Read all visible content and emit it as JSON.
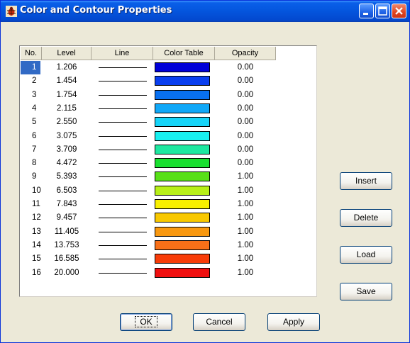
{
  "window": {
    "title": "Color and Contour Properties",
    "title_icon": "bug-app-icon",
    "controls": [
      "minimize-icon",
      "maximize-icon",
      "close-icon"
    ]
  },
  "table": {
    "headers": {
      "no": "No.",
      "level": "Level",
      "line": "Line",
      "color_table": "Color Table",
      "opacity": "Opacity"
    },
    "selected_row": 1,
    "rows": [
      {
        "no": "1",
        "level": "1.206",
        "color": "#0000d8",
        "opacity": "0.00"
      },
      {
        "no": "2",
        "level": "1.454",
        "color": "#0a3ff0",
        "opacity": "0.00"
      },
      {
        "no": "3",
        "level": "1.754",
        "color": "#0870f0",
        "opacity": "0.00"
      },
      {
        "no": "4",
        "level": "2.115",
        "color": "#10a8f8",
        "opacity": "0.00"
      },
      {
        "no": "5",
        "level": "2.550",
        "color": "#16d4f8",
        "opacity": "0.00"
      },
      {
        "no": "6",
        "level": "3.075",
        "color": "#18f0f0",
        "opacity": "0.00"
      },
      {
        "no": "7",
        "level": "3.709",
        "color": "#1ee8a0",
        "opacity": "0.00"
      },
      {
        "no": "8",
        "level": "4.472",
        "color": "#18e030",
        "opacity": "0.00"
      },
      {
        "no": "9",
        "level": "5.393",
        "color": "#58e018",
        "opacity": "1.00"
      },
      {
        "no": "10",
        "level": "6.503",
        "color": "#b8f018",
        "opacity": "1.00"
      },
      {
        "no": "11",
        "level": "7.843",
        "color": "#f8f000",
        "opacity": "1.00"
      },
      {
        "no": "12",
        "level": "9.457",
        "color": "#f8c800",
        "opacity": "1.00"
      },
      {
        "no": "13",
        "level": "11.405",
        "color": "#f89810",
        "opacity": "1.00"
      },
      {
        "no": "14",
        "level": "13.753",
        "color": "#f87018",
        "opacity": "1.00"
      },
      {
        "no": "15",
        "level": "16.585",
        "color": "#f83c08",
        "opacity": "1.00"
      },
      {
        "no": "16",
        "level": "20.000",
        "color": "#f01010",
        "opacity": "1.00"
      }
    ]
  },
  "side_buttons": {
    "insert": "Insert",
    "delete": "Delete",
    "load": "Load",
    "save": "Save"
  },
  "bottom_buttons": {
    "ok": "OK",
    "cancel": "Cancel",
    "apply": "Apply"
  }
}
